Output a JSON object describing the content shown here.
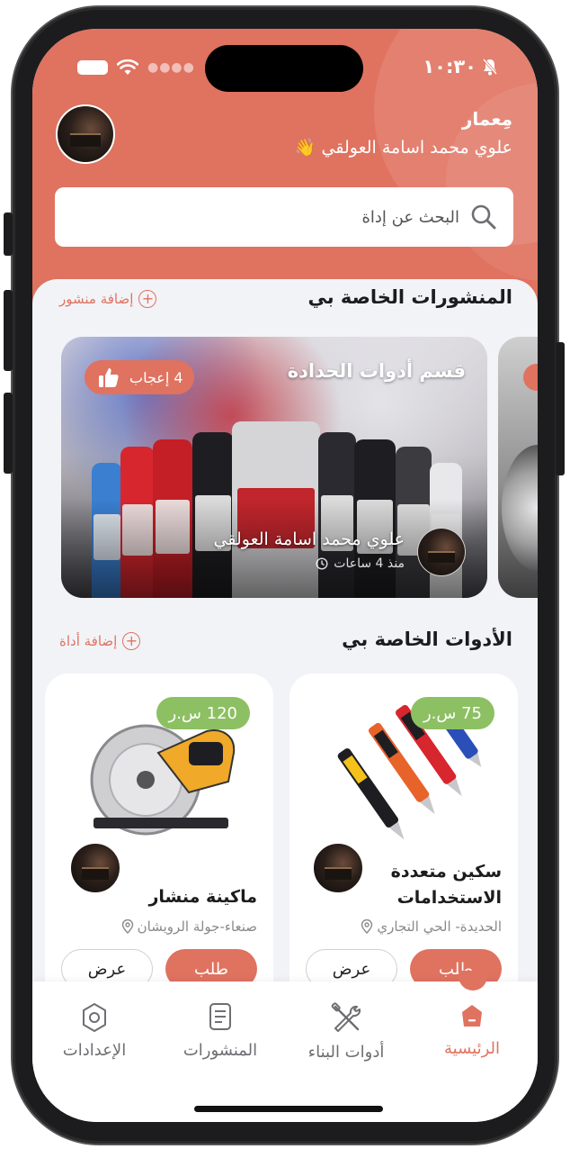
{
  "status_bar": {
    "time": "١٠:٣٠"
  },
  "header": {
    "role": "مِعمار",
    "username": "علوي محمد اسامة العولقي 👋"
  },
  "search": {
    "placeholder": "البحث عن إداة"
  },
  "posts_section": {
    "title": "المنشورات الخاصة بي",
    "add_label": "إضافة منشور"
  },
  "post": {
    "title": "قسم أدوات الحدادة",
    "likes": "4 إعجاب",
    "author": "علوي محمد اسامة العولقي",
    "time": "منذ 4 ساعات"
  },
  "tools_section": {
    "title": "الأدوات الخاصة بي",
    "add_label": "إضافة أداة"
  },
  "tools": [
    {
      "price": "75 س.ر",
      "name": "سكين متعددة الاستخدامات",
      "location": "الحديدة- الحي التجاري",
      "order_label": "طلب",
      "view_label": "عرض"
    },
    {
      "price": "120 س.ر",
      "name": "ماكينة منشار",
      "location": "صنعاء-جولة الرويشان",
      "order_label": "طلب",
      "view_label": "عرض"
    }
  ],
  "tabs": [
    {
      "label": "الرئيسية",
      "icon": "home-icon",
      "active": true
    },
    {
      "label": "أدوات البناء",
      "icon": "tools-icon",
      "active": false
    },
    {
      "label": "المنشورات",
      "icon": "posts-icon",
      "active": false
    },
    {
      "label": "الإعدادات",
      "icon": "settings-icon",
      "active": false
    }
  ],
  "colors": {
    "brand": "#e07260",
    "price_badge": "#8cc063",
    "background": "#f2f3f7"
  }
}
